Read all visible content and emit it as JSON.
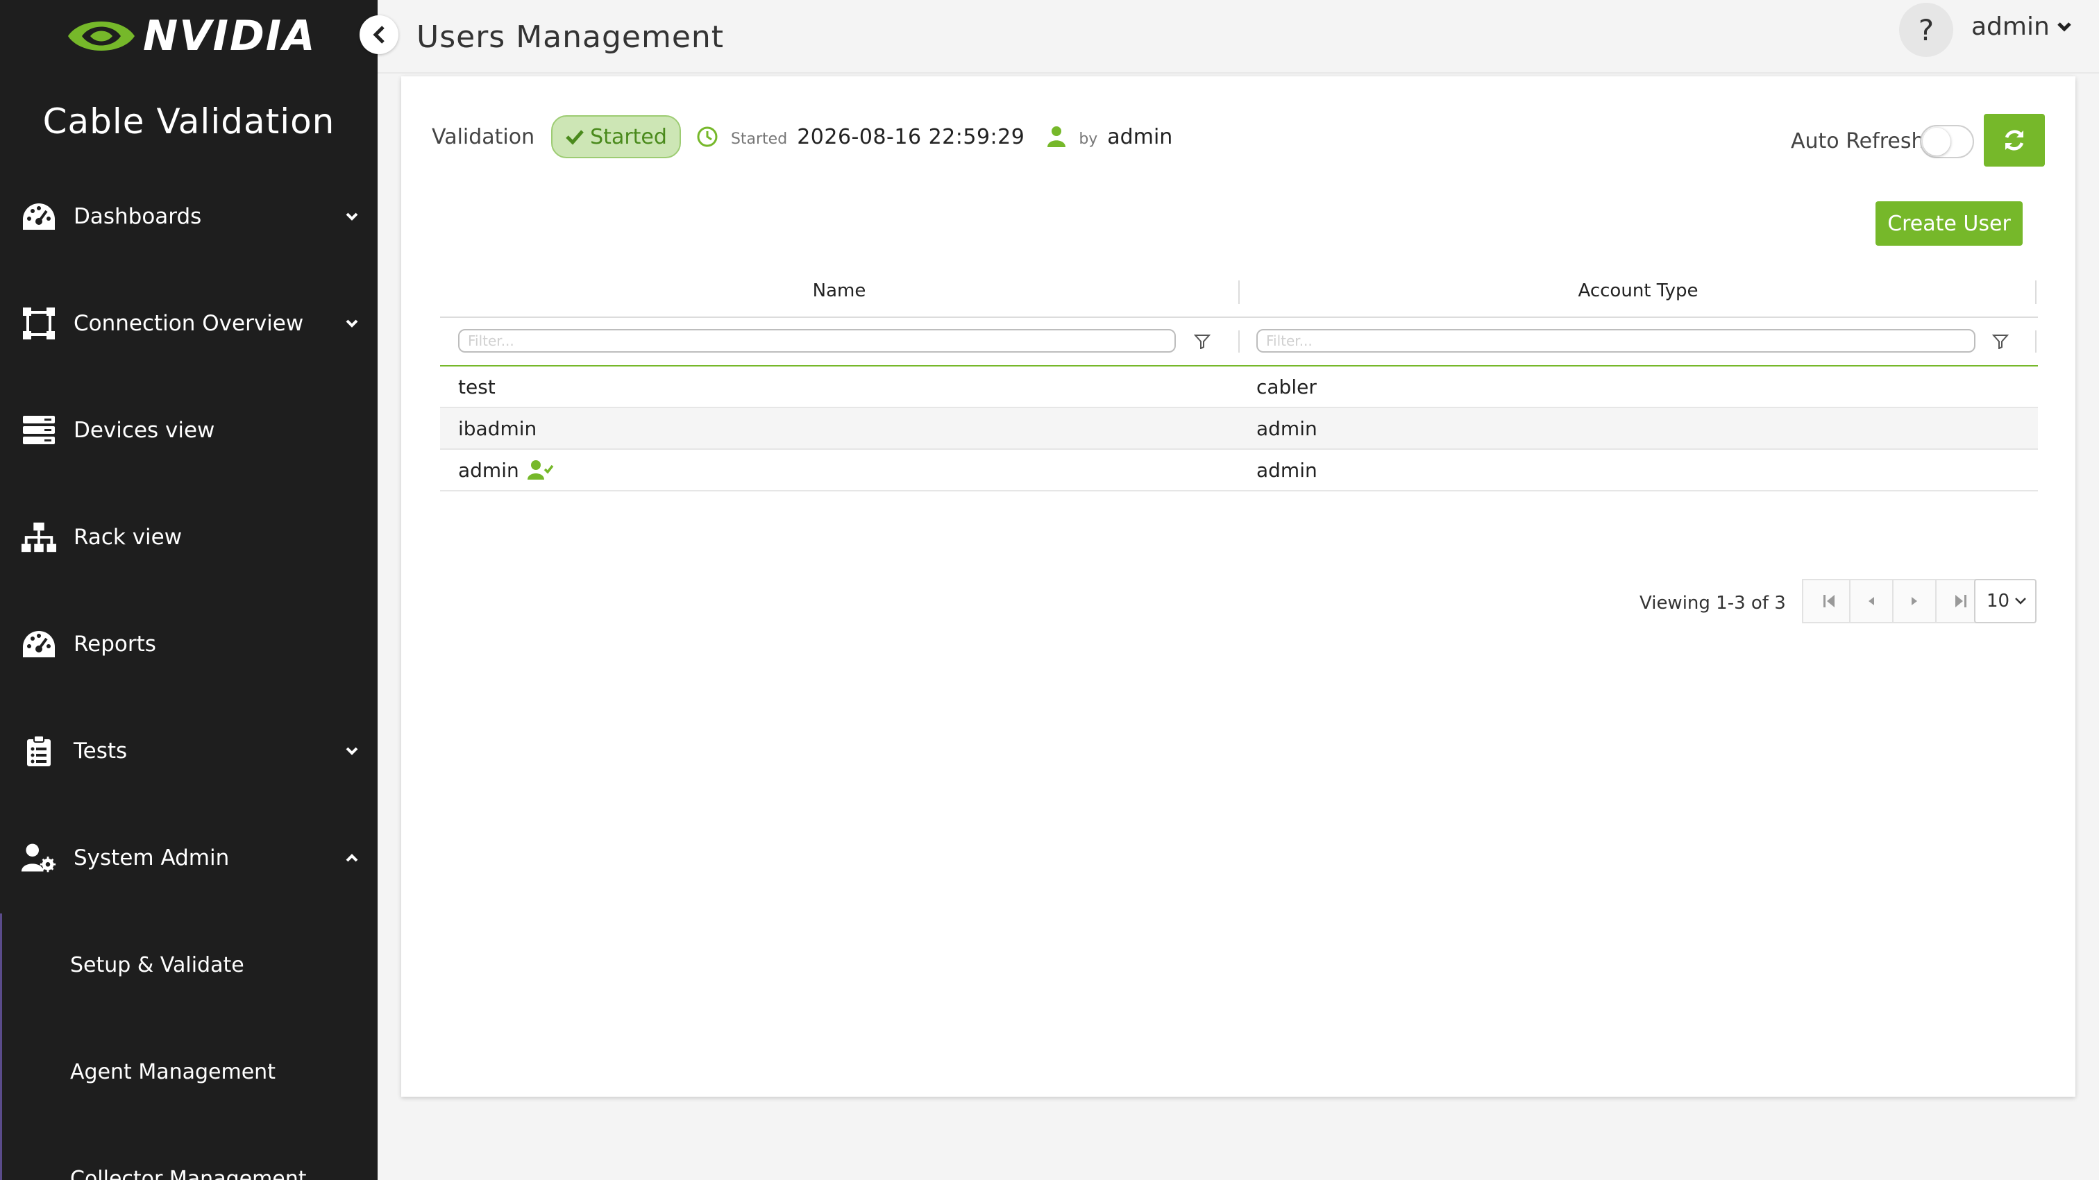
{
  "brand": {
    "logo_text": "NVIDIA",
    "app_title": "Cable Validation",
    "accent_color": "#76b82a"
  },
  "sidebar": {
    "items": [
      {
        "label": "Dashboards",
        "icon": "gauge-icon",
        "expandable": true,
        "expanded": false
      },
      {
        "label": "Connection Overview",
        "icon": "connection-frame-icon",
        "expandable": true,
        "expanded": false
      },
      {
        "label": "Devices view",
        "icon": "server-stack-icon",
        "expandable": false
      },
      {
        "label": "Rack view",
        "icon": "network-tree-icon",
        "expandable": false
      },
      {
        "label": "Reports",
        "icon": "gauge-icon",
        "expandable": false
      },
      {
        "label": "Tests",
        "icon": "clipboard-icon",
        "expandable": true,
        "expanded": false
      },
      {
        "label": "System Admin",
        "icon": "user-gear-icon",
        "expandable": true,
        "expanded": true
      }
    ],
    "sub_items": [
      {
        "label": "Setup & Validate"
      },
      {
        "label": "Agent Management"
      },
      {
        "label": "Collector Management"
      }
    ]
  },
  "header": {
    "page_title": "Users Management",
    "help_label": "?",
    "user_name": "admin"
  },
  "status": {
    "label": "Validation",
    "badge": "Started",
    "started_label": "Started",
    "started_time": "2026-08-16 22:59:29",
    "by_label": "by",
    "by_user": "admin",
    "badge_color": "#cde6b5"
  },
  "toolbar": {
    "auto_refresh_label": "Auto Refresh",
    "auto_refresh_on": false,
    "create_user_label": "Create User"
  },
  "table": {
    "columns": [
      "Name",
      "Account Type"
    ],
    "filter_placeholder": "Filter...",
    "rows": [
      {
        "name": "test",
        "account_type": "cabler",
        "current_user": false
      },
      {
        "name": "ibadmin",
        "account_type": "admin",
        "current_user": false
      },
      {
        "name": "admin",
        "account_type": "admin",
        "current_user": true
      }
    ]
  },
  "pagination": {
    "summary": "Viewing 1-3 of 3",
    "page_size": "10"
  }
}
